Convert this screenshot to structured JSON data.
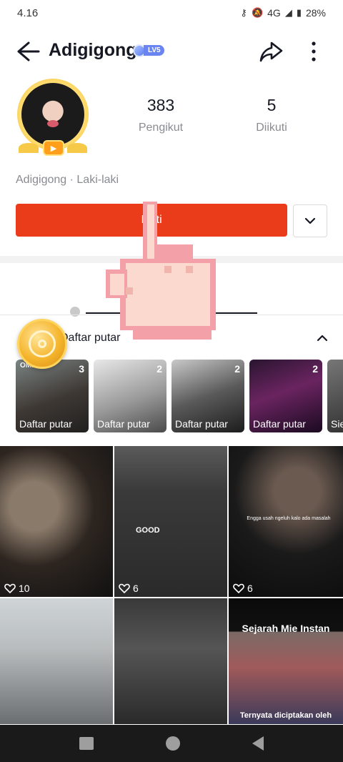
{
  "status_bar": {
    "time": "4.16",
    "network": "4G",
    "battery": "28%"
  },
  "header": {
    "username": "Adigigong",
    "level": "LV5"
  },
  "profile": {
    "followers_count": "383",
    "followers_label": "Pengikut",
    "following_count": "5",
    "following_label": "Diikuti",
    "bio": "Adigigong · Laki-laki"
  },
  "follow_button": {
    "label": "Ikuti"
  },
  "playlists": {
    "title": "Daftar putar",
    "items": [
      {
        "label": "Daftar putar",
        "count": "3",
        "tag": "OMEK"
      },
      {
        "label": "Daftar putar",
        "count": "2",
        "tag": ""
      },
      {
        "label": "Daftar putar",
        "count": "2",
        "tag": ""
      },
      {
        "label": "Daftar putar",
        "count": "2",
        "tag": ""
      },
      {
        "label": "Sie",
        "count": "",
        "tag": ""
      }
    ]
  },
  "videos": [
    {
      "likes": "10",
      "overlay": ""
    },
    {
      "likes": "6",
      "overlay": "GOOD"
    },
    {
      "likes": "6",
      "overlay": "Engga usah ngeluh kalo ada masalah"
    },
    {
      "likes": "",
      "overlay": ""
    },
    {
      "likes": "",
      "overlay": ""
    },
    {
      "likes": "",
      "overlay": "Sejarah Mie Instan",
      "overlay2": "Ternyata diciptakan oleh"
    }
  ],
  "colors": {
    "accent": "#ea3c1a",
    "badge": "#6a85f2",
    "coin": "#f5b52d"
  },
  "icons": [
    "back-arrow-icon",
    "share-icon",
    "more-icon",
    "chevron-down-icon",
    "chevron-up-icon",
    "heart-icon",
    "pointer-hand-icon"
  ]
}
